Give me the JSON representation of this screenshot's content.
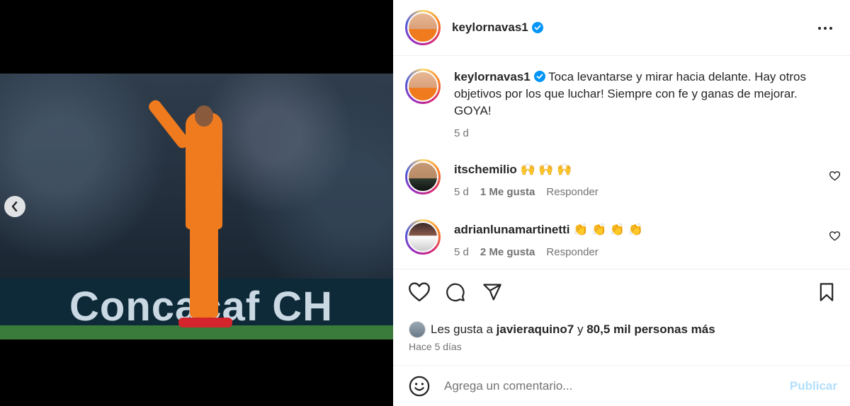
{
  "post": {
    "author": "keylornavas1",
    "caption": "Toca levantarse y mirar hacia delante. Hay otros objetivos por los que luchar! Siempre con fe y ganas de mejorar. GOYA!",
    "age": "5 d",
    "media_ad_text": "Concacaf CH"
  },
  "comments": [
    {
      "user": "itschemilio",
      "text": "🙌 🙌 🙌",
      "age": "5 d",
      "likes": "1 Me gusta",
      "reply": "Responder"
    },
    {
      "user": "adrianlunamartinetti",
      "text": "👏 👏 👏 👏",
      "age": "5 d",
      "likes": "2 Me gusta",
      "reply": "Responder"
    }
  ],
  "likes": {
    "prefix": "Les gusta a",
    "user": "javieraquino7",
    "joiner": "y",
    "others": "80,5 mil personas más"
  },
  "time_ago": "Hace 5 días",
  "composer": {
    "placeholder": "Agrega un comentario...",
    "publish": "Publicar"
  },
  "icons": {
    "verified": "verified-badge-icon",
    "more": "more-options-icon",
    "like": "heart-icon",
    "comment": "comment-bubble-icon",
    "share": "paper-plane-icon",
    "save": "bookmark-icon",
    "emoji": "emoji-icon",
    "prev": "chevron-left-icon"
  },
  "colors": {
    "accent": "#0095f6",
    "publish_disabled": "#b2dffc",
    "muted": "#737373"
  }
}
